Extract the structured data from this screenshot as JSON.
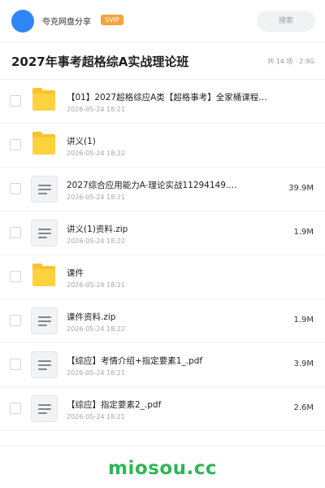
{
  "header": {
    "share_name": "夸克网盘分享",
    "badge": "SVIP",
    "search_placeholder": "搜索"
  },
  "folder": {
    "title": "2027年事考超格综A实战理论班",
    "summary": "共 14 项 · 2.9G"
  },
  "files": [
    {
      "name": "【01】2027超格综应A类【超格事考】全家桶课程…",
      "date": "2026-05-24 18:21",
      "size": "",
      "type": "folder-icon"
    },
    {
      "name": "讲义(1)",
      "date": "2026-05-24 18:22",
      "size": "",
      "type": "folder-icon"
    },
    {
      "name": "2027综合应用能力A-理论实战11294149.…",
      "date": "2026-05-24 18:21",
      "size": "39.9M",
      "type": "file-icon"
    },
    {
      "name": "讲义(1)资料.zip",
      "date": "2026-05-24 18:22",
      "size": "1.9M",
      "type": "file-icon"
    },
    {
      "name": "课件",
      "date": "2026-05-24 18:21",
      "size": "",
      "type": "folder-icon"
    },
    {
      "name": "课件资料.zip",
      "date": "2026-05-24 18:22",
      "size": "1.9M",
      "type": "file-icon"
    },
    {
      "name": "【综应】考情介绍+指定要素1_.pdf",
      "date": "2026-05-24 18:21",
      "size": "3.9M",
      "type": "file-icon"
    },
    {
      "name": "【综应】指定要素2_.pdf",
      "date": "2026-05-24 18:21",
      "size": "2.6M",
      "type": "file-icon"
    }
  ],
  "footer": {
    "watermark": "miosou.cc"
  },
  "colors": {
    "accent": "#2f86f6",
    "svip_badge": "#f6a33a",
    "folder": "#ffd23f",
    "watermark": "#2fb657"
  }
}
